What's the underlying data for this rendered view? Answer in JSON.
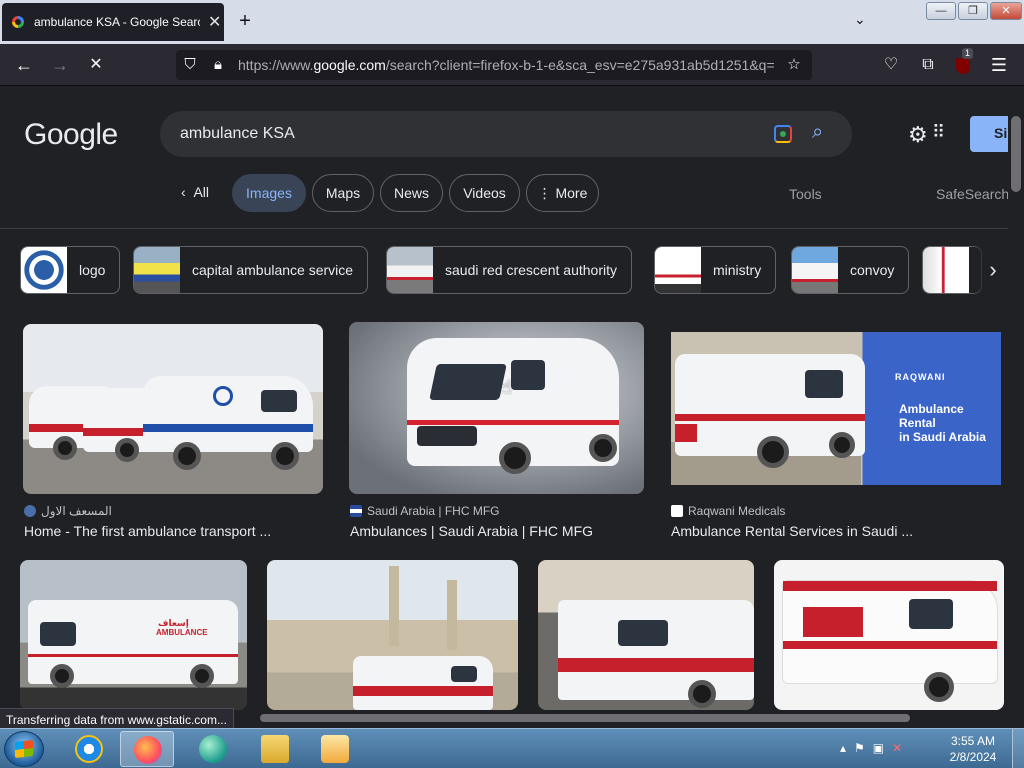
{
  "browser": {
    "tab_title": "ambulance KSA - Google Search",
    "new_tab_label": "+",
    "tab_list_label": "⌄",
    "url_prefix": "https://www.",
    "url_domain": "google.com",
    "url_rest": "/search?client=firefox-b-1-e&sca_esv=e275a931ab5d1251&q=",
    "extension_badge": "1",
    "window": {
      "minimize": "—",
      "restore": "❐",
      "close": "✕"
    }
  },
  "google": {
    "logo_text": "Google",
    "query": "ambulance KSA",
    "signin_label": "Si",
    "tabs": [
      {
        "label": "All"
      },
      {
        "label": "Images"
      },
      {
        "label": "Maps"
      },
      {
        "label": "News"
      },
      {
        "label": "Videos"
      },
      {
        "label": "More"
      }
    ],
    "active_tab": "Images",
    "tools_label": "Tools",
    "safesearch_label": "SafeSearch",
    "refinements": [
      {
        "label": "logo"
      },
      {
        "label": "capital ambulance service"
      },
      {
        "label": "saudi red crescent authority"
      },
      {
        "label": "ministry"
      },
      {
        "label": "convoy"
      }
    ],
    "results": [
      {
        "source": "المسعف الاول",
        "title": "Home - The first ambulance transport ..."
      },
      {
        "source": "Saudi Arabia | FHC MFG",
        "title": "Ambulances | Saudi Arabia | FHC MFG"
      },
      {
        "source": "Raqwani Medicals",
        "title": "Ambulance Rental Services in Saudi ..."
      }
    ],
    "ad_overlay": {
      "brand": "RAQWANI",
      "line1": "Ambulance",
      "line2": "Rental",
      "line3": "in Saudi Arabia"
    },
    "van_text": {
      "arabic": "إسعاف",
      "english": "AMBULANCE"
    }
  },
  "status_text": "Transferring data from www.gstatic.com...",
  "taskbar": {
    "time": "3:55 AM",
    "date": "2/8/2024"
  },
  "colors": {
    "page_bg": "#202124",
    "accent": "#8ab4f8",
    "ambulance_red": "#c6202d"
  },
  "icons": [
    "back-icon",
    "forward-icon",
    "stop-icon",
    "shield-icon",
    "lock-icon",
    "star-icon",
    "pocket-icon",
    "extensions-icon",
    "ublock-icon",
    "menu-icon",
    "lens-icon",
    "search-icon",
    "gear-icon",
    "apps-icon",
    "chevron-right-icon"
  ]
}
